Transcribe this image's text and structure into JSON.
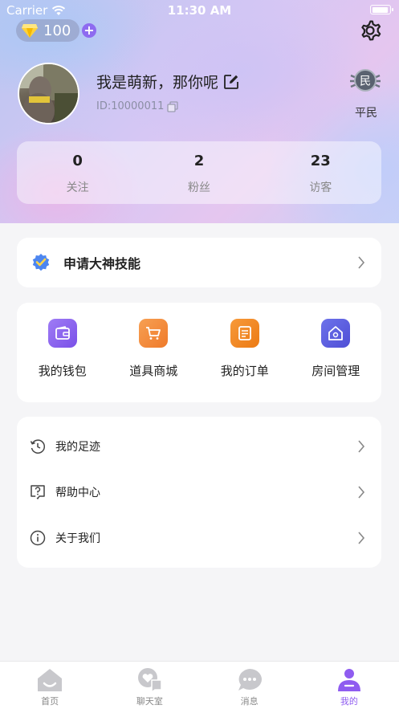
{
  "status_bar": {
    "carrier": "Carrier",
    "time": "11:30 AM"
  },
  "profile": {
    "coins": "100",
    "username": "我是萌新，那你呢",
    "user_id": "ID:10000011",
    "rank_badge_char": "民",
    "rank_label": "平民"
  },
  "stats": [
    {
      "value": "0",
      "label": "关注"
    },
    {
      "value": "2",
      "label": "粉丝"
    },
    {
      "value": "23",
      "label": "访客"
    }
  ],
  "apply_card": {
    "title": "申请大神技能"
  },
  "shortcuts": [
    {
      "label": "我的钱包",
      "icon": "wallet-icon",
      "color": "#8b63f0"
    },
    {
      "label": "道具商城",
      "icon": "cart-icon",
      "color": "#f38a3c"
    },
    {
      "label": "我的订单",
      "icon": "order-icon",
      "color": "#f08a26"
    },
    {
      "label": "房间管理",
      "icon": "home-settings-icon",
      "color": "#5b5fe0"
    }
  ],
  "menu": [
    {
      "label": "我的足迹",
      "icon": "history-icon"
    },
    {
      "label": "帮助中心",
      "icon": "help-icon"
    },
    {
      "label": "关于我们",
      "icon": "info-icon"
    }
  ],
  "tabs": [
    {
      "label": "首页",
      "icon": "home-icon",
      "active": false
    },
    {
      "label": "聊天室",
      "icon": "chatroom-icon",
      "active": false
    },
    {
      "label": "消息",
      "icon": "message-icon",
      "active": false
    },
    {
      "label": "我的",
      "icon": "profile-icon",
      "active": true
    }
  ],
  "colors": {
    "accent": "#8f5cf0",
    "tab_inactive": "#c8c8cc"
  }
}
